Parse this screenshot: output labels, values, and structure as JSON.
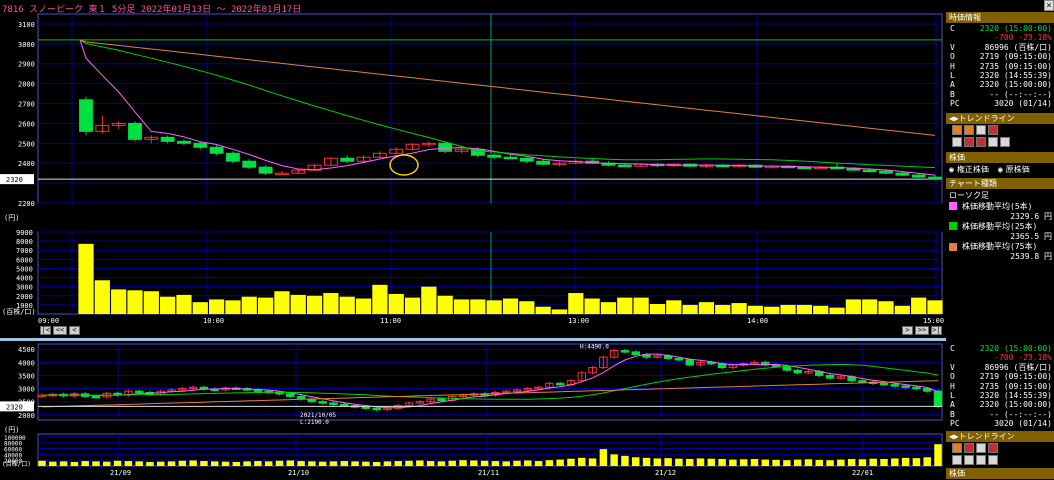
{
  "title": "7816 スノーピーク 東１ 5分足 2022年01月13日 〜 2022年01月17日",
  "current_price_badge": "2320",
  "axis": {
    "main_y_ticks": [
      "3100",
      "3000",
      "2900",
      "2800",
      "2700",
      "2600",
      "2500",
      "2400",
      "2320",
      "2200"
    ],
    "main_y_unit": "(円)",
    "vol_y_ticks": [
      "9000",
      "8000",
      "7000",
      "6000",
      "5000",
      "4000",
      "3000",
      "2000",
      "1000"
    ],
    "vol_y_unit": "(百株/口)",
    "x_ticks": [
      "09:00",
      "10:00",
      "11:00",
      "12:00",
      "13:00",
      "14:00",
      "15:00"
    ],
    "sub_y_ticks": [
      "4500",
      "4000",
      "3500",
      "3000",
      "2500",
      "2320",
      "2000"
    ],
    "sub_y_unit": "(円)",
    "sub_vol_ticks": [
      "100000",
      "80000",
      "60000",
      "40000",
      "20000"
    ],
    "sub_vol_unit": "(百株/口)",
    "sub_x_ticks": [
      "21/09",
      "21/10",
      "21/11",
      "21/12",
      "22/01"
    ]
  },
  "nav": {
    "first": "|<",
    "prev_page": "<<",
    "prev": "<",
    "next": ">",
    "next_page": ">>",
    "last": ">|"
  },
  "annotations": {
    "high": "H:4490.0",
    "low_date": "2021/10/05",
    "low": "L:2190.0"
  },
  "price_info": {
    "header": "時価情報",
    "rows": [
      {
        "k": "C",
        "v": "2320 (15:00:00)",
        "cls": "grn"
      },
      {
        "k": "",
        "v": "-700 -23.18%",
        "cls": "red"
      },
      {
        "k": "V",
        "v": "86996 (百株/口)",
        "cls": ""
      },
      {
        "k": "O",
        "v": "2719 (09:15:00)",
        "cls": ""
      },
      {
        "k": "H",
        "v": "2735 (09:15:00)",
        "cls": ""
      },
      {
        "k": "L",
        "v": "2320 (14:55:39)",
        "cls": ""
      },
      {
        "k": "A",
        "v": "2320 (15:00:00)",
        "cls": ""
      },
      {
        "k": "B",
        "v": "-- (--:--:--)",
        "cls": ""
      },
      {
        "k": "PC",
        "v": "3020 (01/14)",
        "cls": ""
      }
    ]
  },
  "trendline": {
    "label": "トレンドライン"
  },
  "kabuka": {
    "header": "株価",
    "opt1": "権正株価",
    "opt2": "原株価"
  },
  "chart_type": {
    "header": "チャート種類",
    "kind": "ローソク足",
    "ma": [
      {
        "label": "株価移動平均(5本)",
        "value": "2329.6 円",
        "color": "#ff60ff"
      },
      {
        "label": "株価移動平均(25本)",
        "value": "2365.5 円",
        "color": "#00d000"
      },
      {
        "label": "株価移動平均(75本)",
        "value": "2539.8 円",
        "color": "#e08040"
      }
    ]
  },
  "sub_header": "株価",
  "colors": {
    "up": "#ff3030",
    "down": "#00e040",
    "vol": "#ffff00",
    "ma5": "#ff60ff",
    "ma25": "#00d000",
    "ma75": "#e08040",
    "grid": "#0000a0",
    "prevclose": "#00c000"
  },
  "chart_data": [
    {
      "type": "candlestick",
      "title": "7816 スノーピーク 東１ 5分足 2022年01月13日 〜 2022年01月17日",
      "xlabel": "",
      "ylabel": "(円)",
      "ylim": [
        2200,
        3150
      ],
      "x_ticks": [
        "09:00",
        "10:00",
        "11:00",
        "12:00",
        "13:00",
        "14:00",
        "15:00"
      ],
      "prev_close": 3020,
      "last": 2320,
      "candles": [
        [
          2719,
          2735,
          2540,
          2560
        ],
        [
          2560,
          2640,
          2550,
          2590
        ],
        [
          2590,
          2610,
          2570,
          2600
        ],
        [
          2600,
          2610,
          2510,
          2520
        ],
        [
          2520,
          2540,
          2500,
          2530
        ],
        [
          2530,
          2540,
          2500,
          2510
        ],
        [
          2510,
          2520,
          2490,
          2500
        ],
        [
          2500,
          2510,
          2470,
          2480
        ],
        [
          2480,
          2490,
          2440,
          2450
        ],
        [
          2450,
          2460,
          2400,
          2410
        ],
        [
          2410,
          2420,
          2370,
          2380
        ],
        [
          2380,
          2390,
          2340,
          2350
        ],
        [
          2350,
          2360,
          2340,
          2350
        ],
        [
          2350,
          2370,
          2345,
          2365
        ],
        [
          2365,
          2395,
          2360,
          2390
        ],
        [
          2390,
          2430,
          2385,
          2425
        ],
        [
          2425,
          2440,
          2400,
          2410
        ],
        [
          2410,
          2440,
          2405,
          2430
        ],
        [
          2430,
          2460,
          2425,
          2450
        ],
        [
          2450,
          2480,
          2445,
          2470
        ],
        [
          2470,
          2500,
          2465,
          2495
        ],
        [
          2495,
          2510,
          2480,
          2500
        ],
        [
          2500,
          2510,
          2450,
          2460
        ],
        [
          2460,
          2480,
          2450,
          2470
        ],
        [
          2470,
          2480,
          2430,
          2440
        ],
        [
          2440,
          2450,
          2420,
          2430
        ],
        [
          2430,
          2440,
          2420,
          2425
        ],
        [
          2425,
          2430,
          2400,
          2410
        ],
        [
          2410,
          2420,
          2390,
          2395
        ],
        [
          2395,
          2410,
          2385,
          2400
        ],
        [
          2400,
          2420,
          2395,
          2410
        ],
        [
          2410,
          2420,
          2395,
          2400
        ],
        [
          2400,
          2410,
          2385,
          2390
        ],
        [
          2390,
          2400,
          2380,
          2385
        ],
        [
          2385,
          2400,
          2380,
          2395
        ],
        [
          2395,
          2400,
          2380,
          2390
        ],
        [
          2390,
          2400,
          2380,
          2395
        ],
        [
          2395,
          2400,
          2380,
          2385
        ],
        [
          2385,
          2395,
          2375,
          2390
        ],
        [
          2390,
          2395,
          2380,
          2385
        ],
        [
          2385,
          2395,
          2380,
          2390
        ],
        [
          2390,
          2395,
          2375,
          2380
        ],
        [
          2380,
          2390,
          2375,
          2385
        ],
        [
          2385,
          2390,
          2375,
          2380
        ],
        [
          2380,
          2385,
          2370,
          2375
        ],
        [
          2375,
          2385,
          2370,
          2380
        ],
        [
          2380,
          2400,
          2370,
          2375
        ],
        [
          2375,
          2380,
          2360,
          2365
        ],
        [
          2365,
          2375,
          2355,
          2360
        ],
        [
          2360,
          2370,
          2345,
          2350
        ],
        [
          2350,
          2360,
          2335,
          2340
        ],
        [
          2340,
          2350,
          2325,
          2330
        ],
        [
          2330,
          2340,
          2320,
          2320
        ]
      ],
      "volume": [
        7700,
        3700,
        2700,
        2600,
        2500,
        1900,
        2100,
        1300,
        1600,
        1500,
        1900,
        1800,
        2500,
        2100,
        2000,
        2300,
        1900,
        1700,
        3200,
        2200,
        1800,
        3000,
        2000,
        1600,
        1600,
        1500,
        1700,
        1400,
        800,
        500,
        2300,
        1700,
        1300,
        1800,
        1800,
        1100,
        1500,
        1000,
        1300,
        1000,
        1200,
        900,
        800,
        1000,
        1000,
        900,
        700,
        1600,
        1600,
        1400,
        900,
        1800,
        1500
      ],
      "vol_ylim": [
        0,
        9000
      ]
    },
    {
      "type": "candlestick",
      "title": "",
      "ylabel": "(円)",
      "ylim": [
        1800,
        4700
      ],
      "x_ticks": [
        "21/09",
        "21/10",
        "21/11",
        "21/12",
        "22/01"
      ],
      "high": 4490,
      "low": 2190,
      "closes": [
        2750,
        2780,
        2720,
        2800,
        2700,
        2680,
        2820,
        2750,
        2900,
        2850,
        2780,
        2900,
        2950,
        3000,
        3050,
        2980,
        2950,
        3020,
        3000,
        2950,
        2900,
        2850,
        2800,
        2700,
        2600,
        2500,
        2450,
        2400,
        2350,
        2300,
        2250,
        2200,
        2250,
        2350,
        2450,
        2500,
        2600,
        2550,
        2700,
        2750,
        2800,
        2750,
        2850,
        2900,
        2950,
        3000,
        3050,
        3200,
        3150,
        3300,
        3600,
        3800,
        4200,
        4450,
        4400,
        4300,
        4200,
        4250,
        4150,
        4100,
        3900,
        4000,
        3950,
        3800,
        3900,
        3950,
        4000,
        3900,
        3850,
        3700,
        3600,
        3650,
        3500,
        3400,
        3450,
        3300,
        3250,
        3200,
        3150,
        3100,
        3050,
        3000,
        2900,
        2320
      ],
      "volume": [
        18000,
        15000,
        16000,
        14000,
        17000,
        16000,
        15000,
        18000,
        17000,
        16000,
        14000,
        15000,
        16000,
        18000,
        19000,
        17000,
        16000,
        15000,
        14000,
        16000,
        17000,
        16000,
        18000,
        19000,
        17000,
        16000,
        15000,
        16000,
        17000,
        16000,
        15000,
        14000,
        16000,
        17000,
        18000,
        19000,
        17000,
        16000,
        18000,
        20000,
        19000,
        18000,
        17000,
        16000,
        18000,
        19000,
        17000,
        20000,
        22000,
        25000,
        28000,
        26000,
        58000,
        40000,
        35000,
        30000,
        28000,
        26000,
        27000,
        25000,
        24000,
        26000,
        25000,
        24000,
        22000,
        23000,
        24000,
        22000,
        21000,
        20000,
        22000,
        23000,
        21000,
        20000,
        22000,
        24000,
        23000,
        25000,
        24000,
        26000,
        28000,
        27000,
        30000,
        75000
      ],
      "vol_ylim": [
        0,
        110000
      ]
    }
  ]
}
